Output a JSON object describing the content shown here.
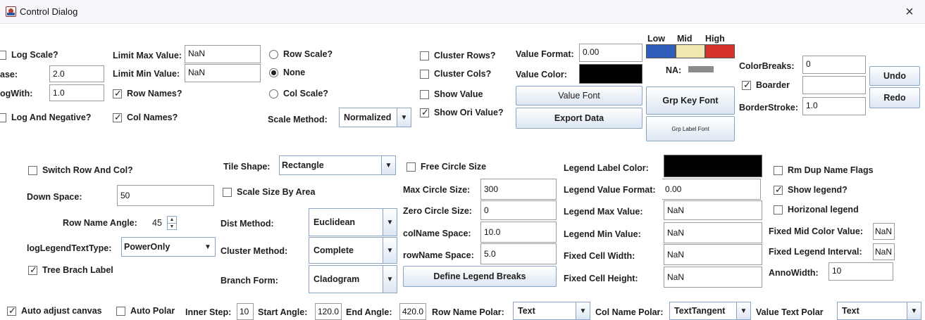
{
  "window": {
    "title": "Control Dialog",
    "close_glyph": "×"
  },
  "log": {
    "log_scale_label": "Log Scale?",
    "base_label": "ase:",
    "base_value": "2.0",
    "log_with_label": "ogWith:",
    "log_with_value": "1.0",
    "log_negative_label": "Log And Negative?"
  },
  "limits": {
    "max_label": "Limit Max Value:",
    "max_value": "NaN",
    "min_label": "Limit Min Value:",
    "min_value": "NaN",
    "row_names_label": "Row Names?",
    "col_names_label": "Col Names?"
  },
  "scale": {
    "row_scale_label": "Row Scale?",
    "none_label": "None",
    "col_scale_label": "Col Scale?",
    "method_label": "Scale Method:",
    "method_value": "Normalized"
  },
  "cluster": {
    "rows_label": "Cluster Rows?",
    "cols_label": "Cluster Cols?",
    "show_value_label": "Show Value",
    "show_ori_label": "Show Ori Value?"
  },
  "value": {
    "format_label": "Value Format:",
    "format_value": "0.00",
    "color_label": "Value Color:",
    "color": "#000000",
    "font_button": "Value Font",
    "export_button": "Export Data"
  },
  "colors": {
    "low_label": "Low",
    "mid_label": "Mid",
    "high_label": "High",
    "low_color": "#2f5dbb",
    "mid_color": "#efe6b0",
    "high_color": "#d9322b",
    "na_label": "NA:",
    "na_color": "#8c8c8c",
    "grp_key_font_button": "Grp Key Font",
    "grp_label_font_button": "Grp Label Font"
  },
  "breaks": {
    "color_breaks_label": "ColorBreaks:",
    "color_breaks_value": "0",
    "boarder_label": "Boarder",
    "boarder_value": "",
    "border_stroke_label": "BorderStroke:",
    "border_stroke_value": "1.0",
    "undo_button": "Undo",
    "redo_button": "Redo"
  },
  "layout": {
    "switch_label": "Switch Row And Col?",
    "down_space_label": "Down Space:",
    "down_space_value": "50",
    "row_name_angle_label": "Row Name Angle:",
    "row_name_angle_value": "45",
    "log_legend_label": "logLegendTextType:",
    "log_legend_value": "PowerOnly",
    "tree_label": "Tree Brach Label"
  },
  "tile": {
    "shape_label": "Tile Shape:",
    "shape_value": "Rectangle",
    "scale_area_label": "Scale Size By Area",
    "dist_label": "Dist Method:",
    "dist_value": "Euclidean",
    "cluster_method_label": "Cluster Method:",
    "cluster_method_value": "Complete",
    "branch_label": "Branch Form:",
    "branch_value": "Cladogram"
  },
  "circle": {
    "free_label": "Free Circle Size",
    "max_label": "Max Circle Size:",
    "max_value": "300",
    "zero_label": "Zero Circle Size:",
    "zero_value": "0",
    "col_space_label": "colName Space:",
    "col_space_value": "10.0",
    "row_space_label": "rowName Space:",
    "row_space_value": "5.0",
    "define_button": "Define Legend Breaks"
  },
  "legend": {
    "label_color_label": "Legend Label Color:",
    "label_color": "#000000",
    "format_label": "Legend Value Format:",
    "format_value": "0.00",
    "max_label": "Legend Max Value:",
    "max_value": "NaN",
    "min_label": "Legend Min Value:",
    "min_value": "NaN",
    "cell_width_label": "Fixed Cell Width:",
    "cell_width_value": "NaN",
    "cell_height_label": "Fixed Cell Height:",
    "cell_height_value": "NaN"
  },
  "flags": {
    "rm_dup_label": "Rm Dup Name Flags",
    "show_legend_label": "Show legend?",
    "horizontal_label": "Horizonal legend",
    "mid_color_label": "Fixed Mid Color Value:",
    "mid_color_value": "NaN",
    "interval_label": "Fixed Legend Interval:",
    "interval_value": "NaN",
    "anno_label": "AnnoWidth:",
    "anno_value": "10"
  },
  "bottom": {
    "auto_adjust_label": "Auto adjust canvas",
    "auto_polar_label": "Auto Polar",
    "inner_step_label": "Inner Step:",
    "inner_step_value": "10",
    "start_angle_label": "Start Angle:",
    "start_angle_value": "120.0",
    "end_angle_label": "End Angle:",
    "end_angle_value": "420.0",
    "row_polar_label": "Row Name Polar:",
    "row_polar_value": "Text",
    "col_polar_label": "Col Name Polar:",
    "col_polar_value": "TextTangent",
    "value_polar_label": "Value Text Polar",
    "value_polar_value": "Text"
  }
}
